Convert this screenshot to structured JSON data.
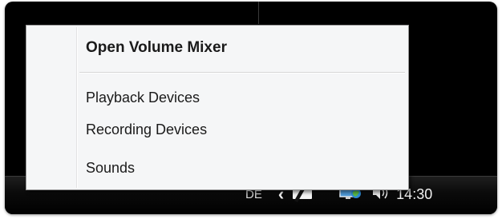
{
  "context_menu": {
    "items": [
      {
        "label": "Open Volume Mixer",
        "default": true
      },
      {
        "label": "Playback Devices",
        "default": false
      },
      {
        "label": "Recording Devices",
        "default": false
      },
      {
        "label": "Sounds",
        "default": false
      }
    ]
  },
  "taskbar": {
    "language": "DE",
    "tray_icons": [
      "show-hidden-icons-chevron-icon",
      "pen-tablet-icon",
      "network-icon",
      "speaker-volume-icon"
    ],
    "clock": "14:30"
  }
}
